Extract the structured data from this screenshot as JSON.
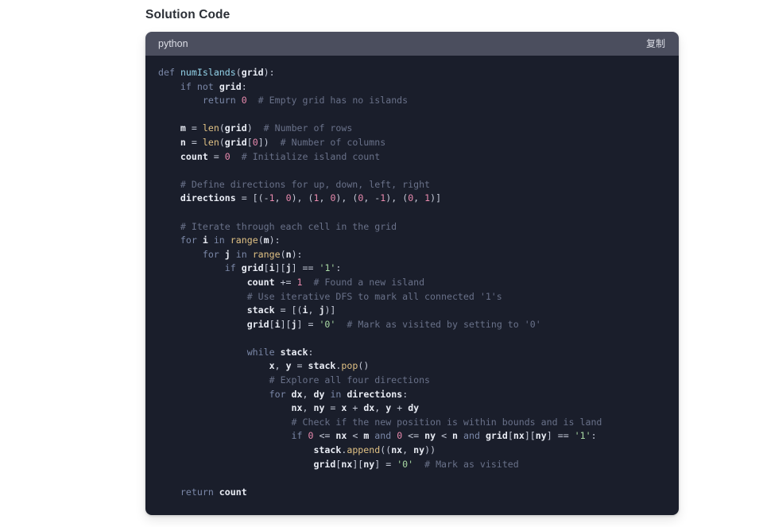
{
  "section": {
    "title": "Solution Code"
  },
  "code_block": {
    "language_label": "python",
    "copy_label": "复制",
    "colors": {
      "header_bg": "#4b4e5e",
      "body_bg": "#1a1e2b",
      "keyword": "#7b88a8",
      "function": "#93d2e8",
      "builtin": "#e0c184",
      "identifier": "#e9ecf4",
      "number": "#e98aae",
      "string": "#a9d9a4",
      "comment": "#697189",
      "operator": "#c3c8d6",
      "page_bg": "#ffffff",
      "title_color": "#2b2f36"
    },
    "code_text": "def numIslands(grid):\n    if not grid:\n        return 0  # Empty grid has no islands\n\n    m = len(grid)  # Number of rows\n    n = len(grid[0])  # Number of columns\n    count = 0  # Initialize island count\n\n    # Define directions for up, down, left, right\n    directions = [(-1, 0), (1, 0), (0, -1), (0, 1)]\n\n    # Iterate through each cell in the grid\n    for i in range(m):\n        for j in range(n):\n            if grid[i][j] == '1':\n                count += 1  # Found a new island\n                # Use iterative DFS to mark all connected '1's\n                stack = [(i, j)]\n                grid[i][j] = '0'  # Mark as visited by setting to '0'\n\n                while stack:\n                    x, y = stack.pop()\n                    # Explore all four directions\n                    for dx, dy in directions:\n                        nx, ny = x + dx, y + dy\n                        # Check if the new position is within bounds and is land\n                        if 0 <= nx < m and 0 <= ny < n and grid[nx][ny] == '1':\n                            stack.append((nx, ny))\n                            grid[nx][ny] = '0'  # Mark as visited\n\n    return count",
    "lines": [
      "def numIslands(grid):",
      "    if not grid:",
      "        return 0  # Empty grid has no islands",
      "",
      "    m = len(grid)  # Number of rows",
      "    n = len(grid[0])  # Number of columns",
      "    count = 0  # Initialize island count",
      "",
      "    # Define directions for up, down, left, right",
      "    directions = [(-1, 0), (1, 0), (0, -1), (0, 1)]",
      "",
      "    # Iterate through each cell in the grid",
      "    for i in range(m):",
      "        for j in range(n):",
      "            if grid[i][j] == '1':",
      "                count += 1  # Found a new island",
      "                # Use iterative DFS to mark all connected '1's",
      "                stack = [(i, j)]",
      "                grid[i][j] = '0'  # Mark as visited by setting to '0'",
      "",
      "                while stack:",
      "                    x, y = stack.pop()",
      "                    # Explore all four directions",
      "                    for dx, dy in directions:",
      "                        nx, ny = x + dx, y + dy",
      "                        # Check if the new position is within bounds and is land",
      "                        if 0 <= nx < m and 0 <= ny < n and grid[nx][ny] == '1':",
      "                            stack.append((nx, ny))",
      "                            grid[nx][ny] = '0'  # Mark as visited",
      "",
      "    return count"
    ]
  }
}
